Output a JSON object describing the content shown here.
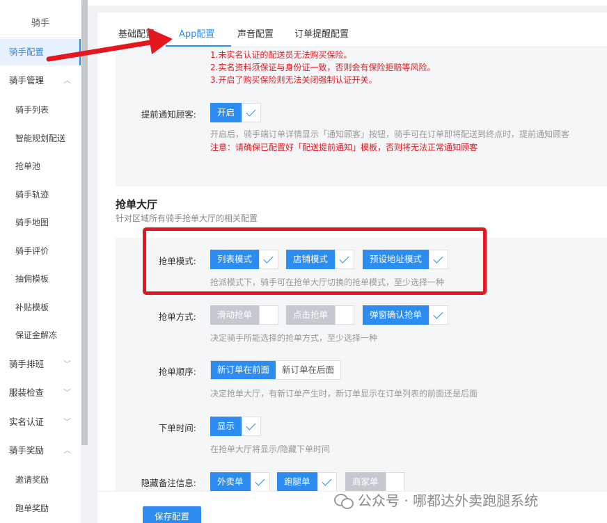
{
  "sidebar": {
    "title": "骑手",
    "items": [
      {
        "label": "骑手配置",
        "active": true,
        "level": 1
      },
      {
        "label": "骑手管理",
        "level": 1,
        "chevron": "up"
      },
      {
        "label": "骑手列表",
        "level": 2
      },
      {
        "label": "智能规划配送",
        "level": 2
      },
      {
        "label": "抢单池",
        "level": 2
      },
      {
        "label": "骑手轨迹",
        "level": 2
      },
      {
        "label": "骑手地图",
        "level": 2
      },
      {
        "label": "骑手评价",
        "level": 2
      },
      {
        "label": "抽佣模板",
        "level": 2
      },
      {
        "label": "补贴模板",
        "level": 2
      },
      {
        "label": "保证金解冻",
        "level": 2
      },
      {
        "label": "骑手排班",
        "level": 1,
        "chevron": "down"
      },
      {
        "label": "服装检查",
        "level": 1,
        "chevron": "down"
      },
      {
        "label": "实名认证",
        "level": 1,
        "chevron": "down"
      },
      {
        "label": "骑手奖励",
        "level": 1,
        "chevron": "up"
      },
      {
        "label": "邀请奖励",
        "level": 2
      },
      {
        "label": "跑单奖励",
        "level": 2
      }
    ]
  },
  "tabs": [
    {
      "label": "基础配置"
    },
    {
      "label": "App配置",
      "active": true
    },
    {
      "label": "声音配置"
    },
    {
      "label": "订单提醒配置"
    }
  ],
  "insurance_notes": [
    "1.未实名认证的配送员无法购买保险。",
    "2.实名资料须保证与身份证一致，否则会有保险拒赔等风险。",
    "3.开启了购买保险则无法关闭强制认证开关。"
  ],
  "notify_customer": {
    "label": "提前通知顾客:",
    "option": "开启",
    "hint": "开启后，骑手端订单详情显示「通知顾客」按钮，骑手可在订单即将配送到终点时，提前通知顾客",
    "warning": "注意：请确保已配置好「配送提前通知」模板，否则将无法正常通知顾客"
  },
  "grab_hall": {
    "title": "抢单大厅",
    "subtitle": "针对区域所有骑手抢单大厅的相关配置",
    "mode": {
      "label": "抢单模式:",
      "options": [
        {
          "label": "列表模式",
          "checked": true
        },
        {
          "label": "店铺模式",
          "checked": true
        },
        {
          "label": "预设地址模式",
          "checked": true
        }
      ],
      "hint": "抢派模式下，骑手可在抢单大厅切换的抢单模式，至少选择一种"
    },
    "method": {
      "label": "抢单方式:",
      "options": [
        {
          "label": "滑动抢单",
          "checked": false
        },
        {
          "label": "点击抢单",
          "checked": false
        },
        {
          "label": "弹窗确认抢单",
          "checked": true
        }
      ],
      "hint": "决定骑手所能选择的抢单方式，至少选择一种"
    },
    "order": {
      "label": "抢单顺序:",
      "options": [
        {
          "label": "新订单在前面",
          "selected": true
        },
        {
          "label": "新订单在后面",
          "selected": false
        }
      ],
      "hint": "决定抢单大厅，有新订单产生时，新订单显示在订单列表的前面还是后面"
    },
    "order_time": {
      "label": "下单时间:",
      "option": "显示",
      "hint": "在抢单大厅将显示/隐藏下单时间"
    },
    "hidden_row": {
      "label": "隐藏备注信息:",
      "options": [
        "外卖单",
        "跑腿单",
        "商家单"
      ]
    }
  },
  "save_label": "保存配置",
  "watermark": "公众号 · 哪都达外卖跑腿系统",
  "colors": {
    "primary": "#2d8cf0",
    "danger": "#e4161e",
    "disabled": "#c5c8ce"
  }
}
